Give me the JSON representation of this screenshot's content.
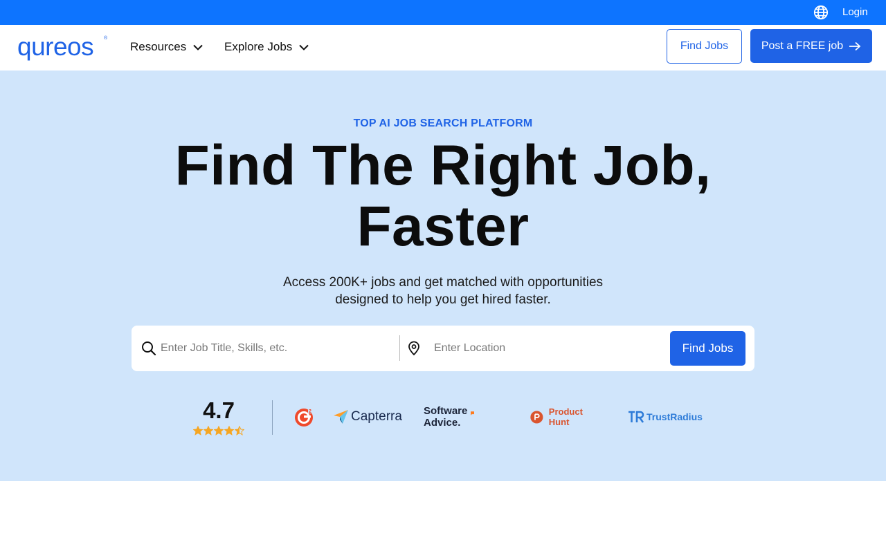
{
  "topbar": {
    "login_label": "Login",
    "globe_icon": "globe-icon"
  },
  "nav": {
    "logo_text": "qureos",
    "menus": [
      {
        "label": "Resources"
      },
      {
        "label": "Explore Jobs"
      }
    ],
    "find_jobs_label": "Find Jobs",
    "post_job_label": "Post a FREE job"
  },
  "hero": {
    "eyebrow": "TOP AI JOB SEARCH PLATFORM",
    "headline_line1": "Find The Right Job,",
    "headline_line2": "Faster",
    "sub_line1": "Access 200K+ jobs and get matched with opportunities",
    "sub_line2": "designed to help you get hired faster."
  },
  "search": {
    "job_placeholder": "Enter Job Title, Skills, etc.",
    "location_placeholder": "Enter Location",
    "button_label": "Find Jobs"
  },
  "rating": {
    "value": "4.7",
    "stars": 4.5,
    "max_stars": 5
  },
  "review_logos": [
    {
      "name": "G2",
      "icon": "g2-logo"
    },
    {
      "name": "Capterra"
    },
    {
      "name": "Software Advice."
    },
    {
      "name": "Product Hunt"
    },
    {
      "name": "TrustRadius"
    }
  ],
  "colors": {
    "accent": "#1f63e6",
    "topbar": "#0d74ff",
    "hero_bg": "#d0e5fb",
    "star": "#f5a623"
  }
}
